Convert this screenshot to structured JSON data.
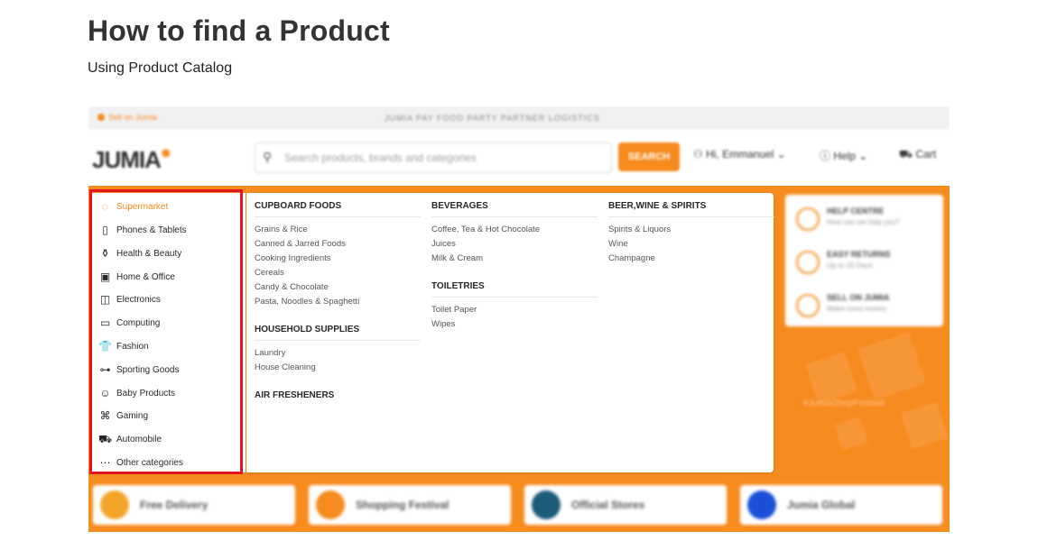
{
  "doc": {
    "title": "How to find a Product",
    "subtitle": "Using Product Catalog"
  },
  "colors": {
    "accent": "#f68b1e",
    "highlight": "#e1141e"
  },
  "topbar": {
    "sell_label": "Sell on Jumia",
    "brands": "JUMIA  PAY  FOOD  PARTY  PARTNER  LOGISTICS"
  },
  "header": {
    "logo": "JUMIA",
    "search_placeholder": "Search products, brands and categories",
    "search_button": "SEARCH",
    "account_label": "Hi, Emmanuel",
    "help_label": "Help",
    "cart_label": "Cart"
  },
  "categories": [
    {
      "label": "Supermarket",
      "icon": "supermarket-icon",
      "glyph": "◌"
    },
    {
      "label": "Phones & Tablets",
      "icon": "phone-icon",
      "glyph": "▯"
    },
    {
      "label": "Health & Beauty",
      "icon": "beauty-icon",
      "glyph": "⚱"
    },
    {
      "label": "Home & Office",
      "icon": "home-office-icon",
      "glyph": "▣"
    },
    {
      "label": "Electronics",
      "icon": "electronics-icon",
      "glyph": "◫"
    },
    {
      "label": "Computing",
      "icon": "computer-icon",
      "glyph": "▭"
    },
    {
      "label": "Fashion",
      "icon": "fashion-icon",
      "glyph": "👕"
    },
    {
      "label": "Sporting Goods",
      "icon": "dumbbell-icon",
      "glyph": "⊶"
    },
    {
      "label": "Baby Products",
      "icon": "baby-icon",
      "glyph": "☺"
    },
    {
      "label": "Gaming",
      "icon": "gamepad-icon",
      "glyph": "⌘"
    },
    {
      "label": "Automobile",
      "icon": "car-icon",
      "glyph": "⛟"
    },
    {
      "label": "Other categories",
      "icon": "more-icon",
      "glyph": "⋯"
    }
  ],
  "flyout": {
    "col1": {
      "g1_title": "CUPBOARD FOODS",
      "g1_items": [
        "Grains & Rice",
        "Canned & Jarred Foods",
        "Cooking Ingredients",
        "Cereals",
        "Candy & Chocolate",
        "Pasta, Noodles & Spaghetti"
      ],
      "g2_title": "HOUSEHOLD SUPPLIES",
      "g2_items": [
        "Laundry",
        "House Cleaning"
      ],
      "g3_title": "AIR FRESHENERS"
    },
    "col2": {
      "g1_title": "BEVERAGES",
      "g1_items": [
        "Coffee, Tea & Hot Chocolate",
        "Juices",
        "Milk & Cream"
      ],
      "g2_title": "TOILETRIES",
      "g2_items": [
        "Toilet Paper",
        "Wipes"
      ]
    },
    "col3": {
      "g1_title": "BEER,WINE & SPIRITS",
      "g1_items": [
        "Spirits & Liquors",
        "Wine",
        "Champagne"
      ]
    }
  },
  "right_card": [
    {
      "title": "HELP CENTRE",
      "sub": "How can we help you?"
    },
    {
      "title": "EASY RETURNS",
      "sub": "Up to 15 Days"
    },
    {
      "title": "SELL ON JUMIA",
      "sub": "Make more money"
    }
  ],
  "hashtag": "#JumiaShopFestival",
  "tiles": [
    {
      "label": "Free Delivery",
      "color": "#f3a52a"
    },
    {
      "label": "Shopping Festival",
      "color": "#f68b1e"
    },
    {
      "label": "Official Stores",
      "color": "#1d5b7a"
    },
    {
      "label": "Jumia Global",
      "color": "#1b4fd8"
    }
  ]
}
